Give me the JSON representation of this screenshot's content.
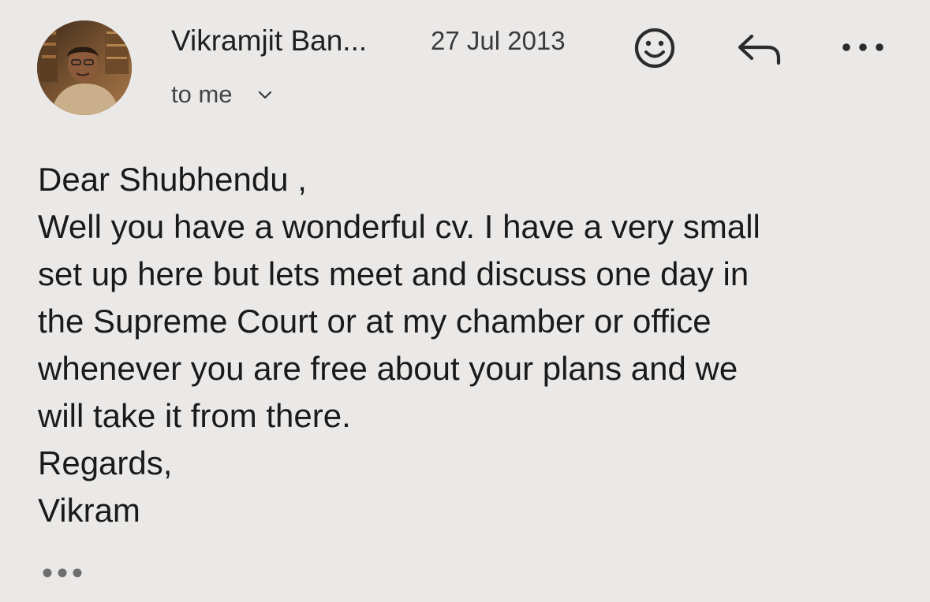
{
  "header": {
    "sender_name": "Vikramjit Ban...",
    "date": "27 Jul 2013",
    "recipient_label": "to me"
  },
  "icons": {
    "avatar": "avatar-photo",
    "emoji": "smiley-icon",
    "reply": "reply-arrow-icon",
    "more": "more-horizontal-icon",
    "expand": "chevron-down-icon",
    "trimmed": "ellipsis-icon"
  },
  "message": {
    "lines": [
      "Dear Shubhendu ,",
      "Well you have a wonderful cv. I have a very small",
      "set up here but lets meet and discuss one day in",
      "the Supreme Court or at my chamber or office",
      "whenever you are free about your plans and we",
      "will take it from there.",
      "Regards,",
      "Vikram"
    ]
  },
  "colors": {
    "background": "#ebe9e8",
    "text": "#1a1a1a",
    "icon": "#2b2b2b",
    "muted": "#6e6e6e"
  }
}
